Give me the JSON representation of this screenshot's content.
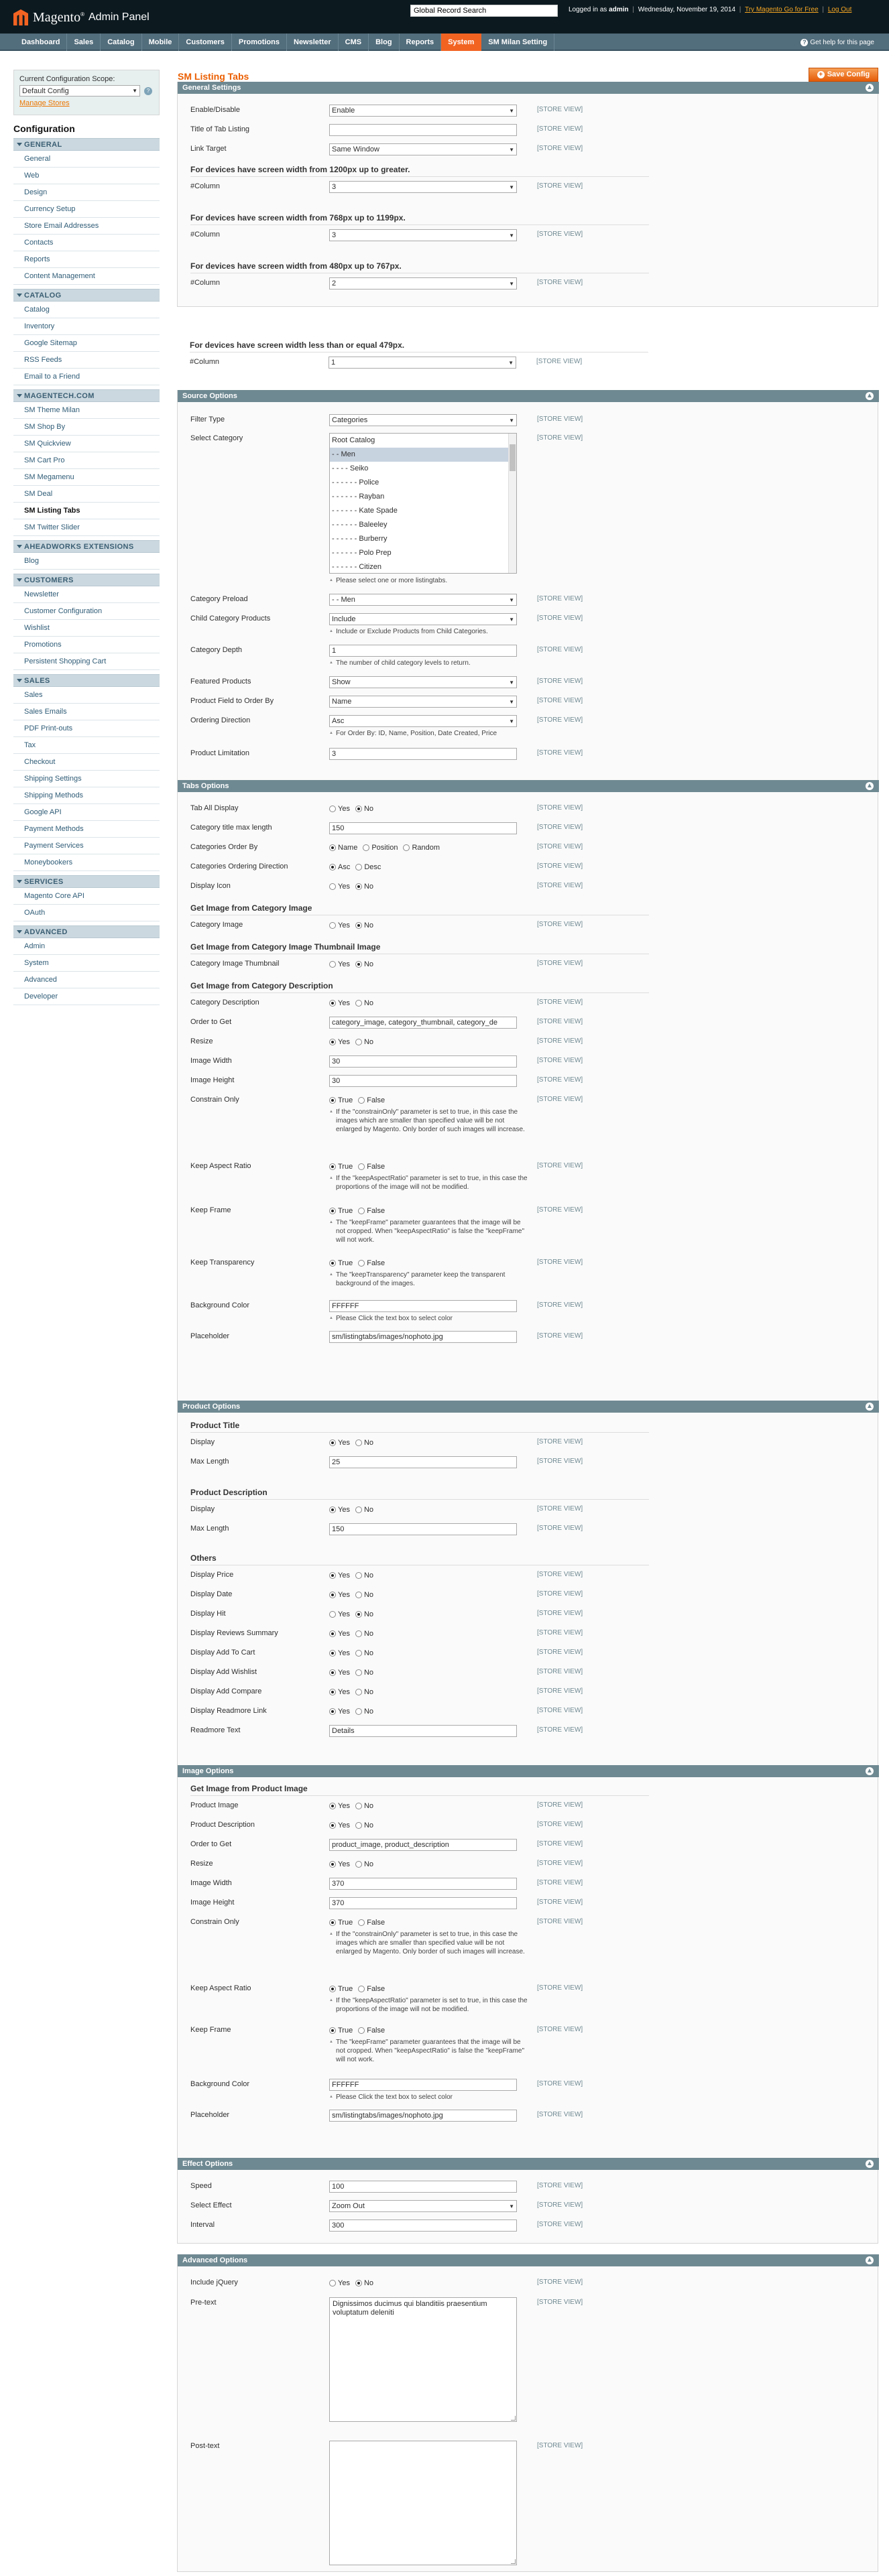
{
  "header": {
    "logo_brand": "Magento",
    "logo_panel": "Admin Panel",
    "search_value": "Global Record Search",
    "logged_in_prefix": "Logged in as",
    "user": "admin",
    "date": "Wednesday, November 19, 2014",
    "try_link": "Try Magento Go for Free",
    "logout_link": "Log Out"
  },
  "nav": {
    "items": [
      "Dashboard",
      "Sales",
      "Catalog",
      "Mobile",
      "Customers",
      "Promotions",
      "Newsletter",
      "CMS",
      "Blog",
      "Reports",
      "System",
      "SM Milan Setting"
    ],
    "active": "System",
    "help": "Get help for this page"
  },
  "sidebar": {
    "scope_label": "Current Configuration Scope:",
    "scope_value": "Default Config",
    "manage_stores": "Manage Stores",
    "title": "Configuration",
    "sections": [
      {
        "head": "GENERAL",
        "items": [
          "General",
          "Web",
          "Design",
          "Currency Setup",
          "Store Email Addresses",
          "Contacts",
          "Reports",
          "Content Management"
        ]
      },
      {
        "head": "CATALOG",
        "items": [
          "Catalog",
          "Inventory",
          "Google Sitemap",
          "RSS Feeds",
          "Email to a Friend"
        ]
      },
      {
        "head": "MAGENTECH.COM",
        "items": [
          "SM Theme Milan",
          "SM Shop By",
          "SM Quickview",
          "SM Cart Pro",
          "SM Megamenu",
          "SM Deal",
          "SM Listing Tabs",
          "SM Twitter Slider"
        ]
      },
      {
        "head": "AHEADWORKS EXTENSIONS",
        "items": [
          "Blog"
        ]
      },
      {
        "head": "CUSTOMERS",
        "items": [
          "Newsletter",
          "Customer Configuration",
          "Wishlist",
          "Promotions",
          "Persistent Shopping Cart"
        ]
      },
      {
        "head": "SALES",
        "items": [
          "Sales",
          "Sales Emails",
          "PDF Print-outs",
          "Tax",
          "Checkout",
          "Shipping Settings",
          "Shipping Methods",
          "Google API",
          "Payment Methods",
          "Payment Services",
          "Moneybookers"
        ]
      },
      {
        "head": "SERVICES",
        "items": [
          "Magento Core API",
          "OAuth"
        ]
      },
      {
        "head": "ADVANCED",
        "items": [
          "Admin",
          "System",
          "Advanced",
          "Developer"
        ]
      }
    ],
    "active_item": "SM Listing Tabs"
  },
  "main": {
    "title": "SM Listing Tabs",
    "save_label": "Save Config",
    "store_view": "[STORE VIEW]"
  },
  "general": {
    "title": "General Settings",
    "enable_label": "Enable/Disable",
    "enable_value": "Enable",
    "tab_title_label": "Title of Tab Listing",
    "tab_title_value": "",
    "link_target_label": "Link Target",
    "link_target_value": "Same Window",
    "h1200": "For devices have screen width from 1200px up to greater.",
    "h768": "For devices have screen width from 768px up to 1199px.",
    "h480": "For devices have screen width from 480px up to 767px.",
    "h479": "For devices have screen width less than or equal 479px.",
    "column_label": "#Column",
    "col1200": "3",
    "col768": "3",
    "col480": "2",
    "col479": "1"
  },
  "source": {
    "title": "Source Options",
    "filter_type_label": "Filter Type",
    "filter_type_value": "Categories",
    "select_category_label": "Select Category",
    "categories": [
      "Root Catalog",
      "- - Men",
      "- - - - Seiko",
      "- - - - - - Police",
      "- - - - - - Rayban",
      "- - - - - - Kate Spade",
      "- - - - - - Baleeley",
      "- - - - - - Burberry",
      "- - - - - - Polo Prep",
      "- - - - - - Citizen"
    ],
    "category_selected": "- - Men",
    "select_category_note": "Please select one or more listingtabs.",
    "preload_label": "Category Preload",
    "preload_value": "- - Men",
    "child_label": "Child Category Products",
    "child_value": "Include",
    "child_note": "Include or Exclude Products from Child Categories.",
    "depth_label": "Category Depth",
    "depth_value": "1",
    "depth_note": "The number of child category levels to return.",
    "featured_label": "Featured Products",
    "featured_value": "Show",
    "order_field_label": "Product Field to Order By",
    "order_field_value": "Name",
    "order_dir_label": "Ordering Direction",
    "order_dir_value": "Asc",
    "order_dir_note": "For Order By: ID, Name, Position, Date Created, Price",
    "limit_label": "Product Limitation",
    "limit_value": "3"
  },
  "tabs": {
    "title": "Tabs Options",
    "tab_all_label": "Tab All Display",
    "title_max_label": "Category title max length",
    "title_max_value": "150",
    "order_by_label": "Categories Order By",
    "order_dir_label": "Categories Ordering Direction",
    "display_icon_label": "Display Icon",
    "img_cat_head": "Get Image from Category Image",
    "cat_image_label": "Category Image",
    "img_thumb_head": "Get Image from Category Image Thumbnail Image",
    "cat_thumb_label": "Category Image Thumbnail",
    "img_desc_head": "Get Image from Category Description",
    "cat_desc_label": "Category Description",
    "order_get_label": "Order to Get",
    "order_get_value": "category_image, category_thumbnail, category_de",
    "resize_label": "Resize",
    "width_label": "Image Width",
    "width_value": "30",
    "height_label": "Image Height",
    "height_value": "30",
    "constrain_label": "Constrain Only",
    "constrain_note": "If the \"constrainOnly\" parameter is set to true, in this case the images which are smaller than specified value will be not enlarged by Magento. Only border of such images will increase.",
    "aspect_label": "Keep Aspect Ratio",
    "aspect_note": "If the \"keepAspectRatio\" parameter is set to true, in this case the proportions of the image will not be modified.",
    "frame_label": "Keep Frame",
    "frame_note": "The \"keepFrame\" parameter guarantees that the image will be not cropped. When \"keepAspectRatio\" is false the \"keepFrame\" will not work.",
    "transp_label": "Keep Transparency",
    "transp_note": "The \"keepTransparency\" parameter keep the transparent background of the images.",
    "bg_label": "Background Color",
    "bg_value": "FFFFFF",
    "bg_note": "Please Click the text box to select color",
    "placeholder_label": "Placeholder",
    "placeholder_value": "sm/listingtabs/images/nophoto.jpg"
  },
  "product": {
    "title": "Product Options",
    "ptitle_head": "Product Title",
    "display_label": "Display",
    "max_label": "Max Length",
    "title_max_value": "25",
    "pdesc_head": "Product Description",
    "desc_max_value": "150",
    "others_head": "Others",
    "price_label": "Display Price",
    "date_label": "Display Date",
    "hit_label": "Display Hit",
    "reviews_label": "Display Reviews Summary",
    "cart_label": "Display Add To Cart",
    "wishlist_label": "Display Add Wishlist",
    "compare_label": "Display Add Compare",
    "readmore_link_label": "Display Readmore Link",
    "readmore_text_label": "Readmore Text",
    "readmore_text_value": "Details"
  },
  "image": {
    "title": "Image Options",
    "head": "Get Image from Product Image",
    "pimage_label": "Product Image",
    "pdesc_label": "Product Description",
    "order_get_label": "Order to Get",
    "order_get_value": "product_image, product_description",
    "resize_label": "Resize",
    "width_label": "Image Width",
    "width_value": "370",
    "height_label": "Image Height",
    "height_value": "370",
    "bg_value": "FFFFFF",
    "placeholder_value": "sm/listingtabs/images/nophoto.jpg"
  },
  "effect": {
    "title": "Effect Options",
    "speed_label": "Speed",
    "speed_value": "100",
    "effect_label": "Select Effect",
    "effect_value": "Zoom Out",
    "interval_label": "Interval",
    "interval_value": "300"
  },
  "advanced": {
    "title": "Advanced Options",
    "jquery_label": "Include jQuery",
    "pretext_label": "Pre-text",
    "pretext_value": "Dignissimos ducimus qui blanditiis praesentium voluptatum deleniti",
    "posttext_label": "Post-text",
    "posttext_value": ""
  },
  "radio": {
    "yes": "Yes",
    "no": "No",
    "true": "True",
    "false": "False",
    "name": "Name",
    "position": "Position",
    "random": "Random",
    "asc": "Asc",
    "desc": "Desc"
  }
}
